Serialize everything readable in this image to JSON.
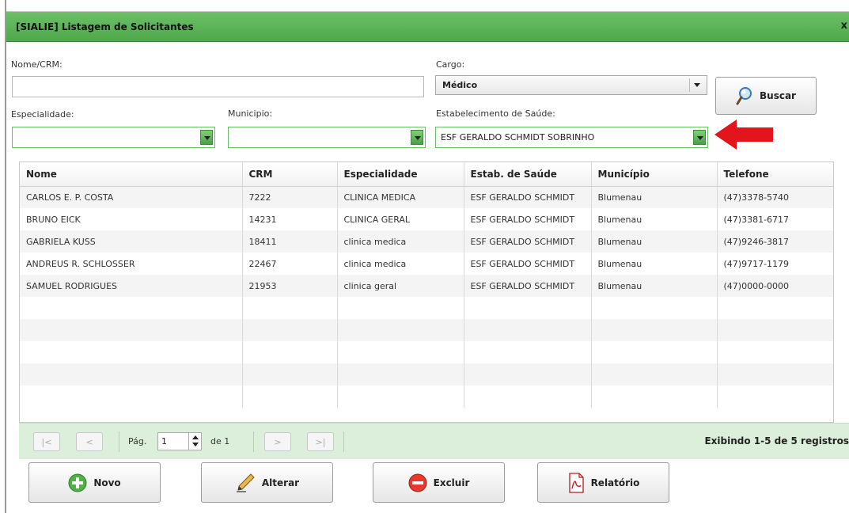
{
  "window": {
    "title": "[SIALIE] Listagem de Solicitantes",
    "close_label": "x"
  },
  "filters": {
    "nome_crm_label": "Nome/CRM:",
    "nome_crm_value": "",
    "cargo_label": "Cargo:",
    "cargo_value": "Médico",
    "especialidade_label": "Especialidade:",
    "especialidade_value": "",
    "municipio_label": "Municipio:",
    "municipio_value": "",
    "estabelecimento_label": "Estabelecimento de Saúde:",
    "estabelecimento_value": "ESF GERALDO SCHMIDT SOBRINHO",
    "search_label": "Buscar"
  },
  "table": {
    "columns": [
      "Nome",
      "CRM",
      "Especialidade",
      "Estab. de Saúde",
      "Município",
      "Telefone"
    ],
    "rows": [
      [
        "CARLOS E. P. COSTA",
        "7222",
        "CLINICA MEDICA",
        "ESF GERALDO SCHMIDT",
        "Blumenau",
        "(47)3378-5740"
      ],
      [
        "BRUNO EICK",
        "14231",
        "CLINICA GERAL",
        "ESF GERALDO SCHMIDT",
        "Blumenau",
        "(47)3381-6717"
      ],
      [
        "GABRIELA KUSS",
        "18411",
        "clinica medica",
        "ESF GERALDO SCHMIDT",
        "Blumenau",
        "(47)9246-3817"
      ],
      [
        "ANDREUS R. SCHLOSSER",
        "22467",
        "clinica medica",
        "ESF GERALDO SCHMIDT",
        "Blumenau",
        "(47)9717-1179"
      ],
      [
        "SAMUEL RODRIGUES",
        "21953",
        "clinica geral",
        "ESF GERALDO SCHMIDT",
        "Blumenau",
        "(47)0000-0000"
      ]
    ]
  },
  "pager": {
    "first": "|<",
    "prev": "<",
    "next": ">",
    "last": ">|",
    "page_label": "Pág.",
    "page_value": "1",
    "of_label": "de 1",
    "status": "Exibindo 1-5 de 5 registros"
  },
  "actions": {
    "novo": "Novo",
    "alterar": "Alterar",
    "excluir": "Excluir",
    "relatorio": "Relatório"
  },
  "colors": {
    "titlebar": "#5cb558",
    "accent_green": "#4aa046",
    "pager_bg": "#dcefdb",
    "arrow_red": "#e3141b"
  },
  "icons": [
    "search-icon",
    "add-icon",
    "edit-pencil-icon",
    "delete-icon",
    "pdf-icon",
    "red-arrow-pointer-icon"
  ]
}
